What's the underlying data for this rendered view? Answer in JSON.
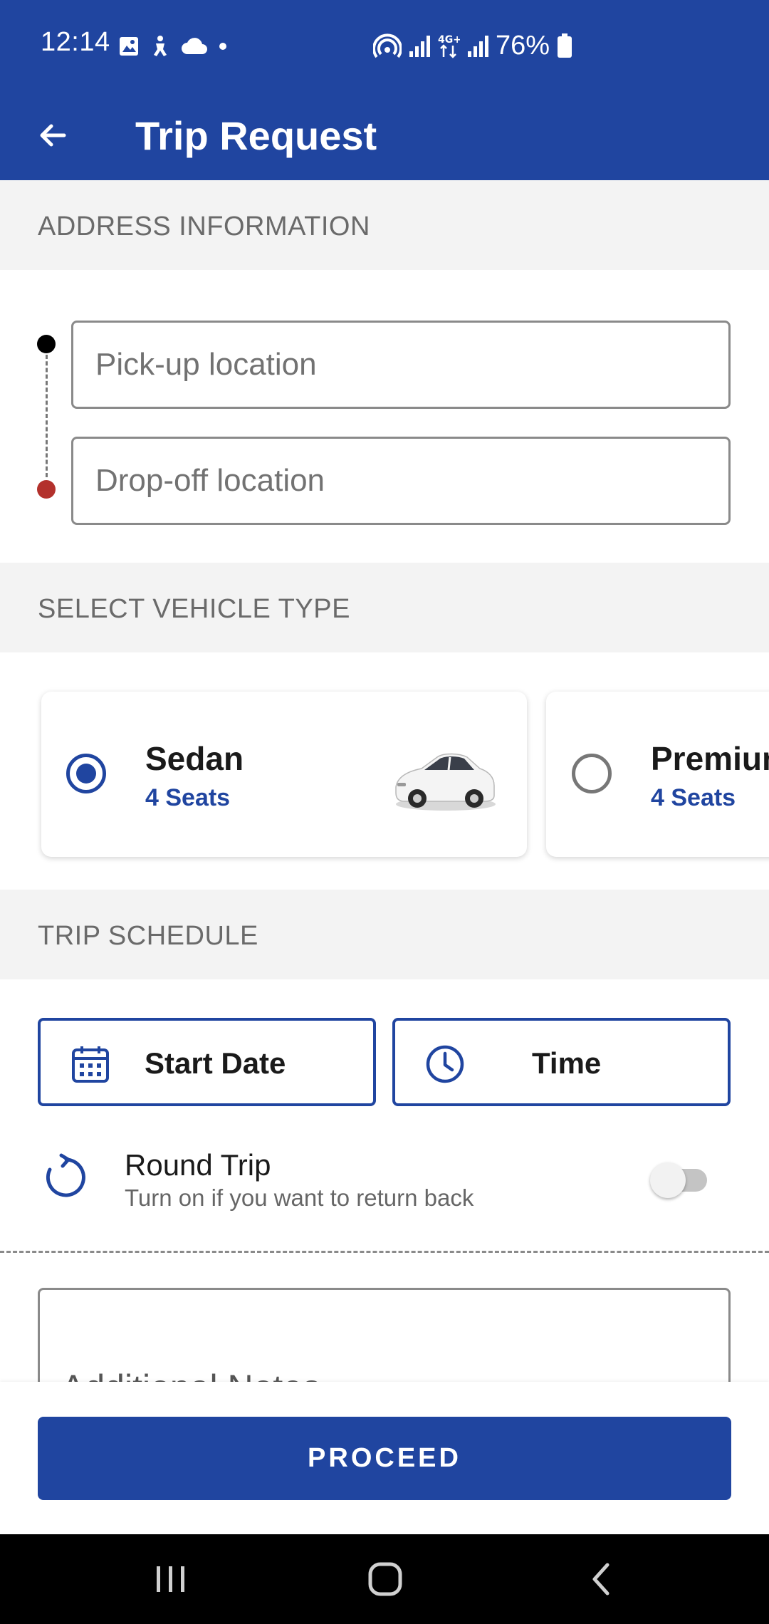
{
  "status_bar": {
    "time": "12:14",
    "battery": "76%",
    "icons": [
      "gallery-icon",
      "accessibility-icon",
      "cloud-icon",
      "dot-icon",
      "hotspot-icon",
      "signal-icon",
      "4g-icon",
      "signal-icon",
      "battery-icon"
    ]
  },
  "app_bar": {
    "title": "Trip Request",
    "back_icon": "arrow-back-icon"
  },
  "sections": {
    "address": "ADDRESS INFORMATION",
    "vehicle": "SELECT VEHICLE TYPE",
    "schedule": "TRIP SCHEDULE"
  },
  "address": {
    "pickup_placeholder": "Pick-up location",
    "dropoff_placeholder": "Drop-off location",
    "pickup_value": "",
    "dropoff_value": ""
  },
  "vehicles": [
    {
      "name": "Sedan",
      "seats": "4 Seats",
      "selected": true
    },
    {
      "name": "Premium",
      "seats": "4 Seats",
      "selected": false
    }
  ],
  "schedule": {
    "start_date_label": "Start Date",
    "time_label": "Time",
    "round_trip_title": "Round Trip",
    "round_trip_subtitle": "Turn on if you want to return back",
    "round_trip_on": false
  },
  "notes": {
    "placeholder": "Additional Notes"
  },
  "actions": {
    "proceed_label": "PROCEED"
  },
  "colors": {
    "primary": "#2045a0",
    "section_bg": "#f3f3f3",
    "dropoff_dot": "#b3312c"
  }
}
